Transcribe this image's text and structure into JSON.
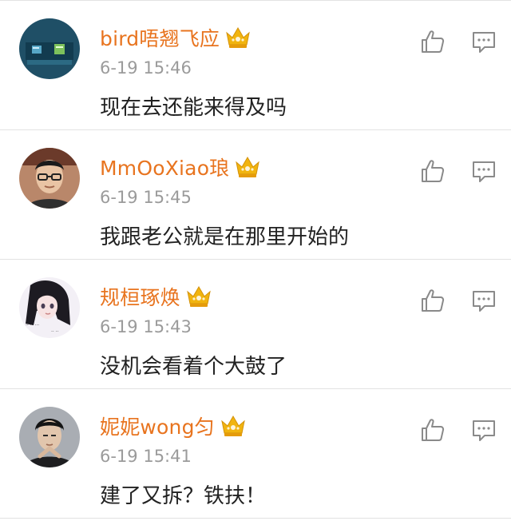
{
  "comments": [
    {
      "username": "bird唔翘飞应",
      "time": "6-19 15:46",
      "text": "现在去还能来得及吗",
      "avatar": "avatar-teal-blocks"
    },
    {
      "username": "MmOoXiao琅",
      "time": "6-19 15:45",
      "text": "我跟老公就是在那里开始的",
      "avatar": "avatar-man-glasses"
    },
    {
      "username": "规桓琢焕",
      "time": "6-19 15:43",
      "text": "没机会看着个大鼓了",
      "avatar": "avatar-anime-girl"
    },
    {
      "username": "妮妮wong匀",
      "time": "6-19 15:41",
      "text": "建了又拆？铁扶！",
      "avatar": "avatar-man-dark"
    }
  ],
  "icons": {
    "badge": "crown-icon",
    "like": "thumbs-up-icon",
    "reply": "comment-icon"
  },
  "colors": {
    "username": "#e8741f",
    "badge": "#f1b40f",
    "time": "#9b9b9b",
    "text": "#222222",
    "icon": "#8a8a8a",
    "divider": "#e2e2e2"
  }
}
